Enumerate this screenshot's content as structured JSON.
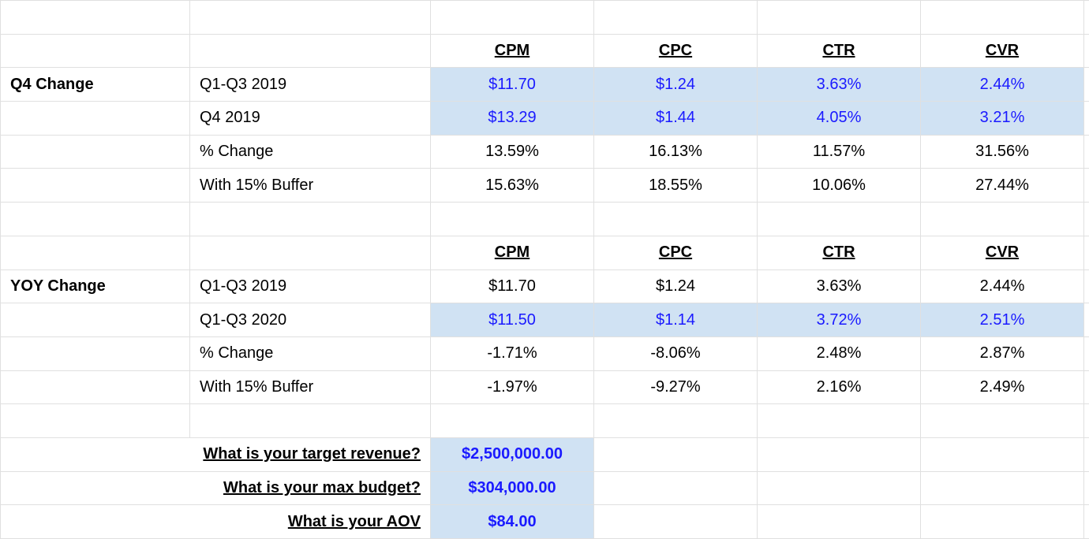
{
  "headers": {
    "cpm": "CPM",
    "cpc": "CPC",
    "ctr": "CTR",
    "cvr": "CVR"
  },
  "q4": {
    "title": "Q4 Change",
    "rows": [
      {
        "label": "Q1-Q3 2019",
        "cpm": "$11.70",
        "cpc": "$1.24",
        "ctr": "3.63%",
        "cvr": "2.44%",
        "hl": true
      },
      {
        "label": "Q4 2019",
        "cpm": "$13.29",
        "cpc": "$1.44",
        "ctr": "4.05%",
        "cvr": "3.21%",
        "hl": true
      },
      {
        "label": "% Change",
        "cpm": "13.59%",
        "cpc": "16.13%",
        "ctr": "11.57%",
        "cvr": "31.56%",
        "hl": false
      },
      {
        "label": "With 15% Buffer",
        "cpm": "15.63%",
        "cpc": "18.55%",
        "ctr": "10.06%",
        "cvr": "27.44%",
        "hl": false
      }
    ]
  },
  "yoy": {
    "title": "YOY Change",
    "rows": [
      {
        "label": "Q1-Q3 2019",
        "cpm": "$11.70",
        "cpc": "$1.24",
        "ctr": "3.63%",
        "cvr": "2.44%",
        "hl": false
      },
      {
        "label": "Q1-Q3 2020",
        "cpm": "$11.50",
        "cpc": "$1.14",
        "ctr": "3.72%",
        "cvr": "2.51%",
        "hl": true
      },
      {
        "label": "% Change",
        "cpm": "-1.71%",
        "cpc": "-8.06%",
        "ctr": "2.48%",
        "cvr": "2.87%",
        "hl": false
      },
      {
        "label": "With 15% Buffer",
        "cpm": "-1.97%",
        "cpc": "-9.27%",
        "ctr": "2.16%",
        "cvr": "2.49%",
        "hl": false
      }
    ]
  },
  "questions": [
    {
      "label": "What is your target revenue?",
      "value": "$2,500,000.00"
    },
    {
      "label": "What is your max budget?",
      "value": "$304,000.00"
    },
    {
      "label": "What is your AOV",
      "value": "$84.00"
    }
  ],
  "chart_data": {
    "type": "table",
    "sections": [
      {
        "name": "Q4 Change",
        "columns": [
          "CPM",
          "CPC",
          "CTR",
          "CVR"
        ],
        "rows": {
          "Q1-Q3 2019": [
            11.7,
            1.24,
            0.0363,
            0.0244
          ],
          "Q4 2019": [
            13.29,
            1.44,
            0.0405,
            0.0321
          ],
          "% Change": [
            0.1359,
            0.1613,
            0.1157,
            0.3156
          ],
          "With 15% Buffer": [
            0.1563,
            0.1855,
            0.1006,
            0.2744
          ]
        }
      },
      {
        "name": "YOY Change",
        "columns": [
          "CPM",
          "CPC",
          "CTR",
          "CVR"
        ],
        "rows": {
          "Q1-Q3 2019": [
            11.7,
            1.24,
            0.0363,
            0.0244
          ],
          "Q1-Q3 2020": [
            11.5,
            1.14,
            0.0372,
            0.0251
          ],
          "% Change": [
            -0.0171,
            -0.0806,
            0.0248,
            0.0287
          ],
          "With 15% Buffer": [
            -0.0197,
            -0.0927,
            0.0216,
            0.0249
          ]
        }
      }
    ],
    "inputs": {
      "target_revenue": 2500000.0,
      "max_budget": 304000.0,
      "aov": 84.0
    }
  }
}
